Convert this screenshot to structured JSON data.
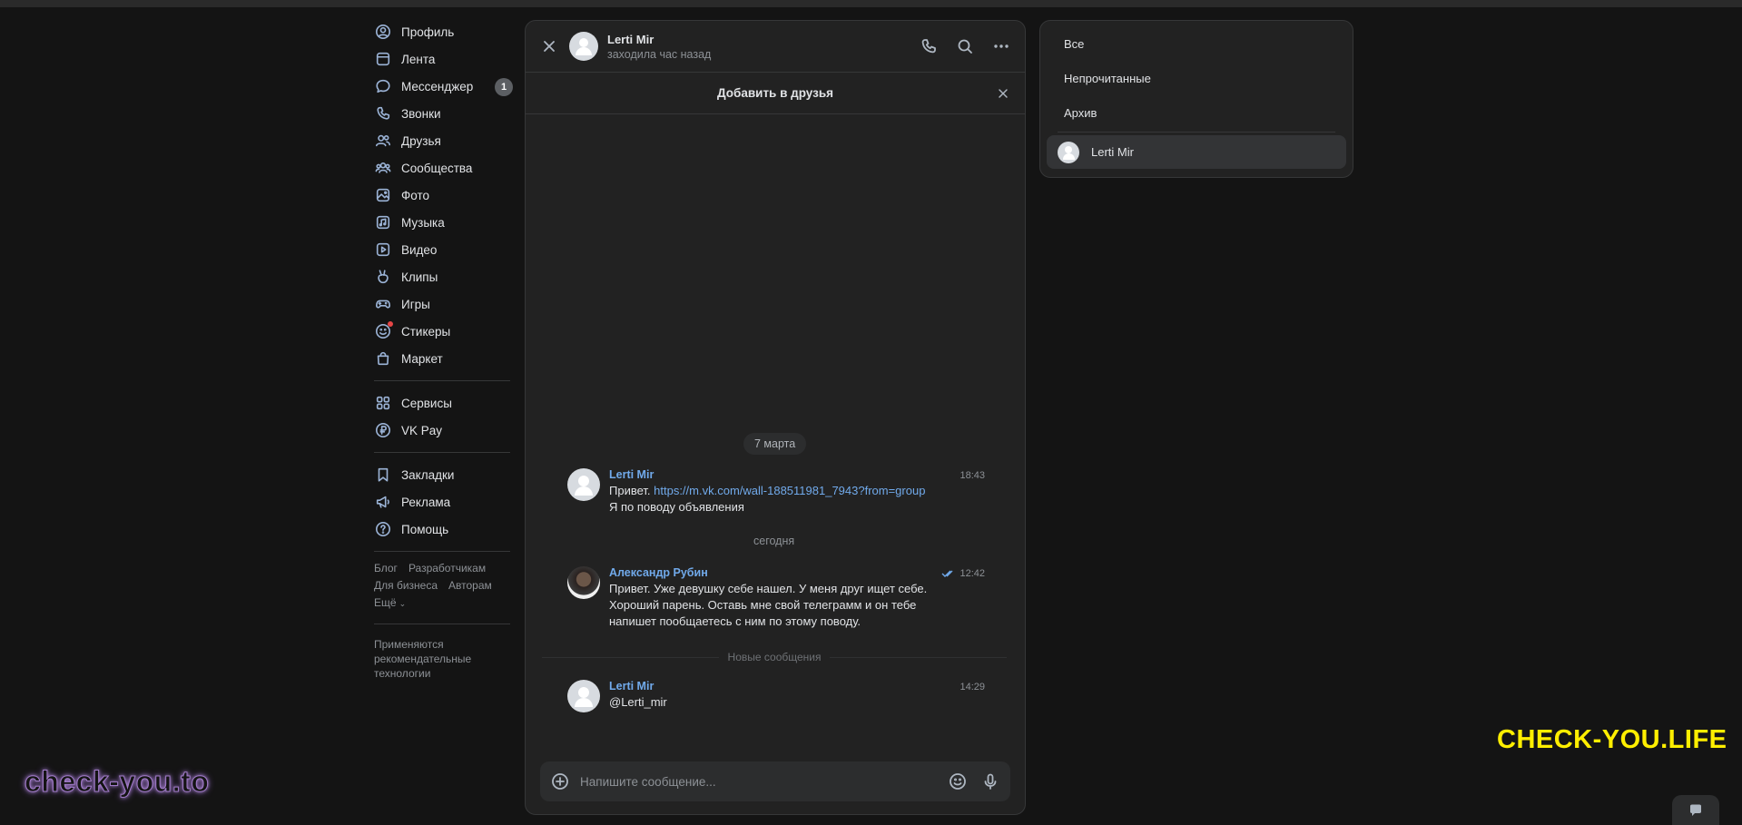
{
  "nav": {
    "main": [
      {
        "icon": "profile-icon",
        "label": "Профиль"
      },
      {
        "icon": "feed-icon",
        "label": "Лента"
      },
      {
        "icon": "messenger-icon",
        "label": "Мессенджер",
        "badge": "1"
      },
      {
        "icon": "phone-icon",
        "label": "Звонки"
      },
      {
        "icon": "friends-icon",
        "label": "Друзья"
      },
      {
        "icon": "communities-icon",
        "label": "Сообщества"
      },
      {
        "icon": "photo-icon",
        "label": "Фото"
      },
      {
        "icon": "music-icon",
        "label": "Музыка"
      },
      {
        "icon": "video-icon",
        "label": "Видео"
      },
      {
        "icon": "clips-icon",
        "label": "Клипы"
      },
      {
        "icon": "games-icon",
        "label": "Игры"
      },
      {
        "icon": "stickers-icon",
        "label": "Стикеры"
      },
      {
        "icon": "market-icon",
        "label": "Маркет"
      }
    ],
    "secondary": [
      {
        "icon": "services-icon",
        "label": "Сервисы"
      },
      {
        "icon": "vkpay-icon",
        "label": "VK Pay"
      }
    ],
    "tertiary": [
      {
        "icon": "bookmarks-icon",
        "label": "Закладки"
      },
      {
        "icon": "ads-icon",
        "label": "Реклама"
      },
      {
        "icon": "help-icon",
        "label": "Помощь"
      }
    ],
    "footer_links": {
      "blog": "Блог",
      "developers": "Разработчикам",
      "business": "Для бизнеса",
      "authors": "Авторам",
      "more": "Ещё"
    },
    "notice": "Применяются рекомендательные технологии"
  },
  "chat": {
    "contact_name": "Lerti Mir",
    "contact_status": "заходила час назад",
    "add_friend": "Добавить в друзья",
    "date_1": "7 марта",
    "date_2": "сегодня",
    "new_messages": "Новые сообщения",
    "messages": [
      {
        "name": "Lerti Mir",
        "time": "18:43",
        "prefix": "Привет. ",
        "link": "https://m.vk.com/wall-188511981_7943?from=group",
        "line2": "Я по поводу объявления"
      },
      {
        "name": "Александр Рубин",
        "time": "12:42",
        "text": "Привет. Уже девушку себе нашел. У меня друг ищет себе. Хороший парень. Оставь мне свой телеграмм и он тебе напишет пообщаетесь с ним по этому поводу."
      },
      {
        "name": "Lerti Mir",
        "time": "14:29",
        "text": "@Lerti_mir"
      }
    ],
    "composer_placeholder": "Напишите сообщение..."
  },
  "filters": {
    "all": "Все",
    "unread": "Непрочитанные",
    "archive": "Архив",
    "active_chat": "Lerti Mir"
  },
  "watermarks": {
    "left": "check-you.to",
    "right": "CHECK-YOU.LIFE"
  }
}
